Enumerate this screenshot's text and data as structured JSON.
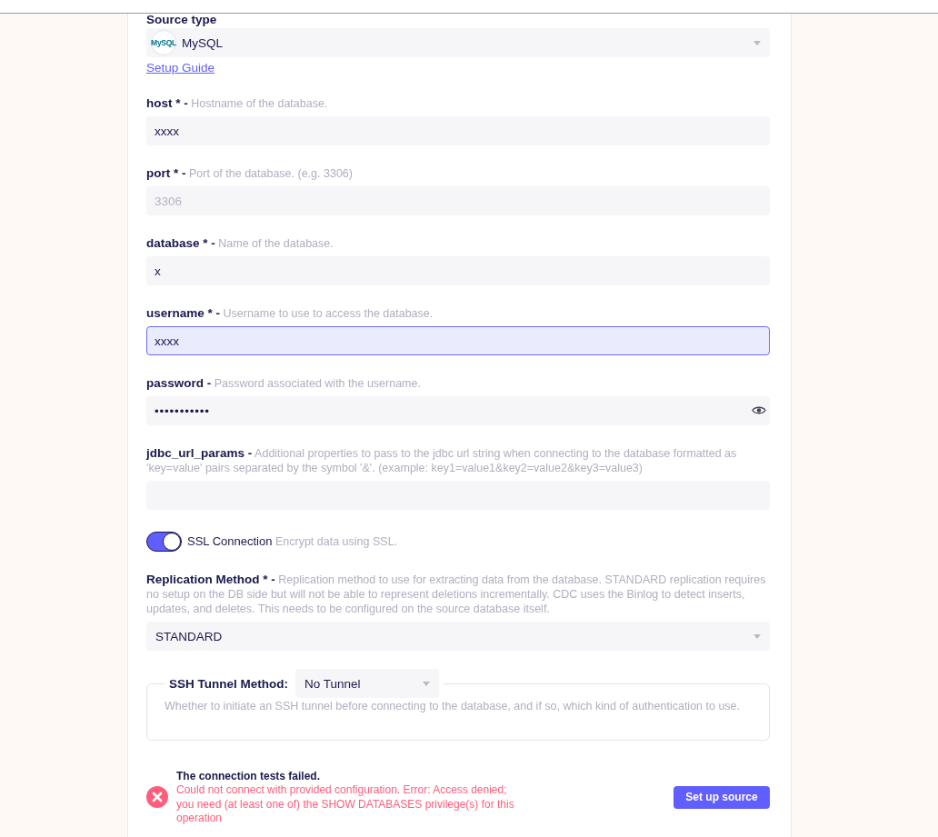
{
  "source": {
    "label": "Source type",
    "logo_text": "MySQL",
    "value": "MySQL",
    "guide_link": "Setup Guide"
  },
  "fields": [
    {
      "kind": "text",
      "label": "host * -",
      "description": "Hostname of the database.",
      "value": "xxxx",
      "focused": false
    },
    {
      "kind": "text",
      "label": "port * -",
      "description": "Port of the database. (e.g. 3306)",
      "placeholder": "3306",
      "focused": false
    },
    {
      "kind": "text",
      "label": "database * -",
      "description": "Name of the database.",
      "value": "x",
      "focused": false
    },
    {
      "kind": "text",
      "label": "username * -",
      "description": "Username to use to access the database.",
      "value": "xxxx",
      "focused": true
    },
    {
      "kind": "password",
      "label": "password -",
      "description": "Password associated with the username.",
      "value": "•••••••••••",
      "focused": false
    },
    {
      "kind": "text",
      "label": "jdbc_url_params -",
      "description": "Additional properties to pass to the jdbc url string when connecting to the database formatted as 'key=value' pairs separated by the symbol '&'. (example: key1=value1&key2=value2&key3=value3)",
      "focused": false
    },
    {
      "kind": "toggle",
      "label": "SSL Connection",
      "description": "Encrypt data using SSL.",
      "on": true
    },
    {
      "kind": "select",
      "label": "Replication Method * -",
      "description": "Replication method to use for extracting data from the database. STANDARD replication requires no setup on the DB side but will not be able to represent deletions incrementally. CDC uses the Binlog to detect inserts, updates, and deletes. This needs to be configured on the source database itself.",
      "value": "STANDARD"
    }
  ],
  "ssh_tunnel": {
    "label": "SSH Tunnel Method:",
    "value": "No Tunnel",
    "description": "Whether to initiate an SSH tunnel before connecting to the database, and if so, which kind of authentication to use."
  },
  "status": {
    "title": "The connection tests failed.",
    "message": "Could not connect with provided configuration. Error: Access denied; you need (at least one of) the SHOW DATABASES privilege(s) for this operation"
  },
  "submit_button": "Set up source"
}
